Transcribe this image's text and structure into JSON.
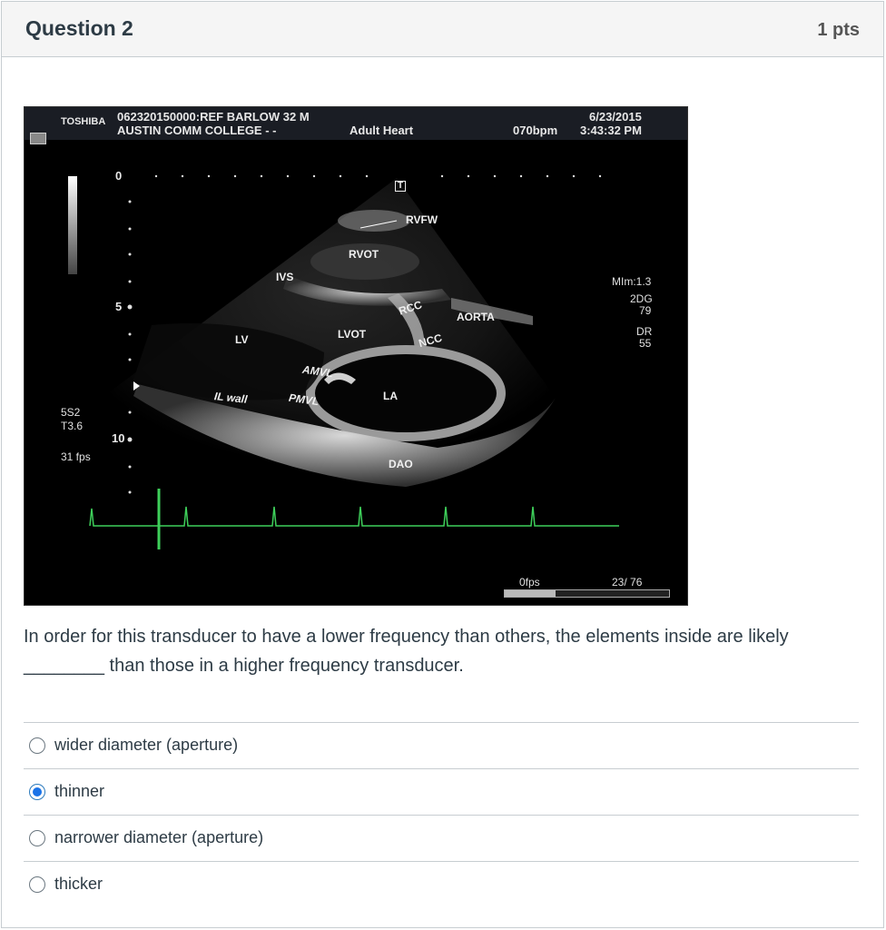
{
  "header": {
    "title": "Question 2",
    "points": "1 pts"
  },
  "ultrasound": {
    "brand": "TOSHIBA",
    "patient_line": "062320150000:REF BARLOW   32  M",
    "institution": "AUSTIN COMM COLLEGE     - -",
    "exam": "Adult Heart",
    "heart_rate": "070bpm",
    "date": "6/23/2015",
    "time": "3:43:32 PM",
    "depth_labels": [
      "0",
      "5",
      "10"
    ],
    "probe": "5S2",
    "tis": "T3.6",
    "fps": "31 fps",
    "mi": "MIm:1.3",
    "gain": "2DG",
    "gain_value": "79",
    "dr": "DR",
    "dr_value": "55",
    "frame_fps": "0fps",
    "frame_counter": "23/  76",
    "marker": "T",
    "labels": {
      "rvfw": "RVFW",
      "rvot": "RVOT",
      "ivs": "IVS",
      "rcc": "RCC",
      "aorta": "AORTA",
      "lv": "LV",
      "lvot": "LVOT",
      "ncc": "NCC",
      "amvl": "AMVL",
      "la": "LA",
      "ilwall": "IL wall",
      "pmvl": "PMVL",
      "dao": "DAO"
    }
  },
  "question": {
    "text": "In order for this transducer to have a lower frequency than others, the elements inside are likely ________ than those in a higher frequency transducer."
  },
  "answers": [
    {
      "label": "wider diameter (aperture)",
      "selected": false
    },
    {
      "label": "thinner",
      "selected": true
    },
    {
      "label": "narrower diameter (aperture)",
      "selected": false
    },
    {
      "label": "thicker",
      "selected": false
    }
  ],
  "colors": {
    "accent": "#1a73e8",
    "ecg": "#3ecf5a",
    "header_bg": "#f5f5f5"
  }
}
